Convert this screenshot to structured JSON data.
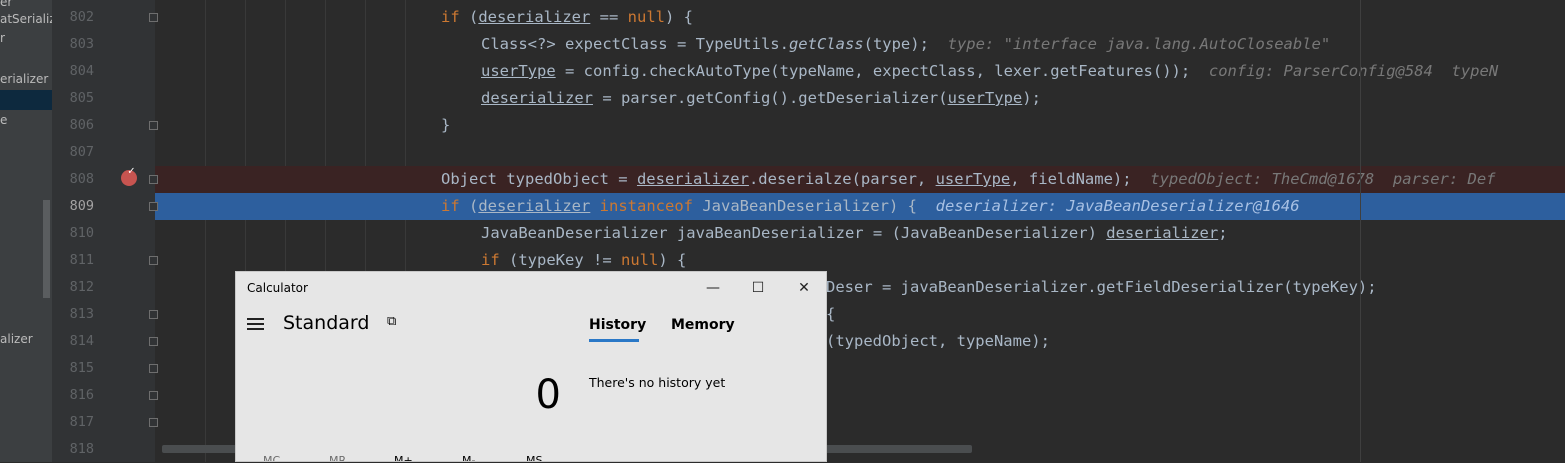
{
  "sidebar": {
    "items": [
      {
        "label": "er"
      },
      {
        "label": "atSerializ"
      },
      {
        "label": "r"
      },
      {
        "label": "erializer"
      },
      {
        "label": ""
      },
      {
        "label": "e"
      },
      {
        "label": "alizer"
      }
    ]
  },
  "editor": {
    "lines": [
      {
        "num": "802",
        "parts": [
          {
            "t": "if",
            "c": "kw"
          },
          {
            "t": " ("
          },
          {
            "t": "deserializer",
            "c": "ul"
          },
          {
            "t": " == "
          },
          {
            "t": "null",
            "c": "kw"
          },
          {
            "t": ") {"
          }
        ]
      },
      {
        "num": "803",
        "parts": [
          {
            "t": "Class<?> expectClass = TypeUtils."
          },
          {
            "t": "getClass",
            "c": "it"
          },
          {
            "t": "(type);  "
          },
          {
            "t": "type: \"interface java.lang.AutoCloseable\"",
            "c": "hint"
          }
        ]
      },
      {
        "num": "804",
        "parts": [
          {
            "t": "userType",
            "c": "ul"
          },
          {
            "t": " = config.checkAutoType(typeName, expectClass, lexer.getFeatures());  "
          },
          {
            "t": "config: ParserConfig@584  typeN",
            "c": "hint"
          }
        ]
      },
      {
        "num": "805",
        "parts": [
          {
            "t": "deserializer",
            "c": "ul"
          },
          {
            "t": " = parser.getConfig().getDeserializer("
          },
          {
            "t": "userType",
            "c": "ul"
          },
          {
            "t": ");"
          }
        ]
      },
      {
        "num": "806",
        "parts": [
          {
            "t": "}"
          }
        ]
      },
      {
        "num": "807",
        "parts": []
      },
      {
        "num": "808",
        "parts": [
          {
            "t": "Object typedObject = "
          },
          {
            "t": "deserializer",
            "c": "ul"
          },
          {
            "t": ".deserialze(parser, "
          },
          {
            "t": "userType",
            "c": "ul"
          },
          {
            "t": ", fieldName);  "
          },
          {
            "t": "typedObject: TheCmd@1678  parser: Def",
            "c": "hint"
          }
        ]
      },
      {
        "num": "809",
        "parts": [
          {
            "t": "if",
            "c": "kw"
          },
          {
            "t": " ("
          },
          {
            "t": "deserializer",
            "c": "ul"
          },
          {
            "t": " "
          },
          {
            "t": "instanceof",
            "c": "kw"
          },
          {
            "t": " JavaBeanDeserializer) {  "
          },
          {
            "t": "deserializer: JavaBeanDeserializer@1646",
            "c": "hint"
          }
        ]
      },
      {
        "num": "810",
        "parts": [
          {
            "t": "JavaBeanDeserializer javaBeanDeserializer = (JavaBeanDeserializer) "
          },
          {
            "t": "deserializer",
            "c": "ul"
          },
          {
            "t": ";"
          }
        ]
      },
      {
        "num": "811",
        "parts": [
          {
            "t": "if",
            "c": "kw"
          },
          {
            "t": " (typeKey != "
          },
          {
            "t": "null",
            "c": "kw"
          },
          {
            "t": ") {"
          }
        ]
      },
      {
        "num": "812",
        "parts": [
          {
            "t": "Deser = javaBeanDeserializer.getFieldDeserializer(typeKey);"
          }
        ]
      },
      {
        "num": "813",
        "parts": [
          {
            "t": "{"
          }
        ]
      },
      {
        "num": "814",
        "parts": [
          {
            "t": "(typedObject, typeName);"
          }
        ]
      },
      {
        "num": "815",
        "parts": []
      },
      {
        "num": "816",
        "parts": []
      },
      {
        "num": "817",
        "parts": []
      },
      {
        "num": "818",
        "parts": []
      }
    ]
  },
  "calculator": {
    "title": "Calculator",
    "mode": "Standard",
    "tab_history": "History",
    "tab_memory": "Memory",
    "display": "0",
    "no_history": "There's no history yet",
    "minimize_icon": "—",
    "maximize_icon": "☐",
    "close_icon": "✕",
    "keep_on_top_icon": "⧉",
    "memory_buttons": [
      "MC",
      "MR",
      "M+",
      "M-",
      "MS"
    ]
  },
  "colors": {
    "keyword": "#cc7832",
    "execution_line": "#2d5f9e",
    "breakpoint": "#c75450"
  }
}
